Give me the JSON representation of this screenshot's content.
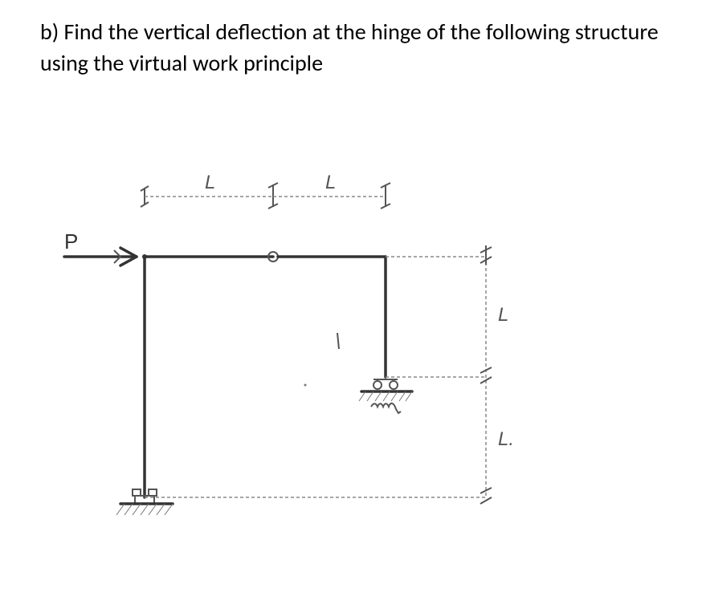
{
  "problem": {
    "text": "b) Find the vertical deflection at the hinge of the following structure using the virtual work principle"
  },
  "figure": {
    "load_label": "P",
    "dim_L_top_left": "L",
    "dim_L_top_right": "L",
    "dim_L_right_upper": "L",
    "dim_L_right_lower": "L."
  }
}
